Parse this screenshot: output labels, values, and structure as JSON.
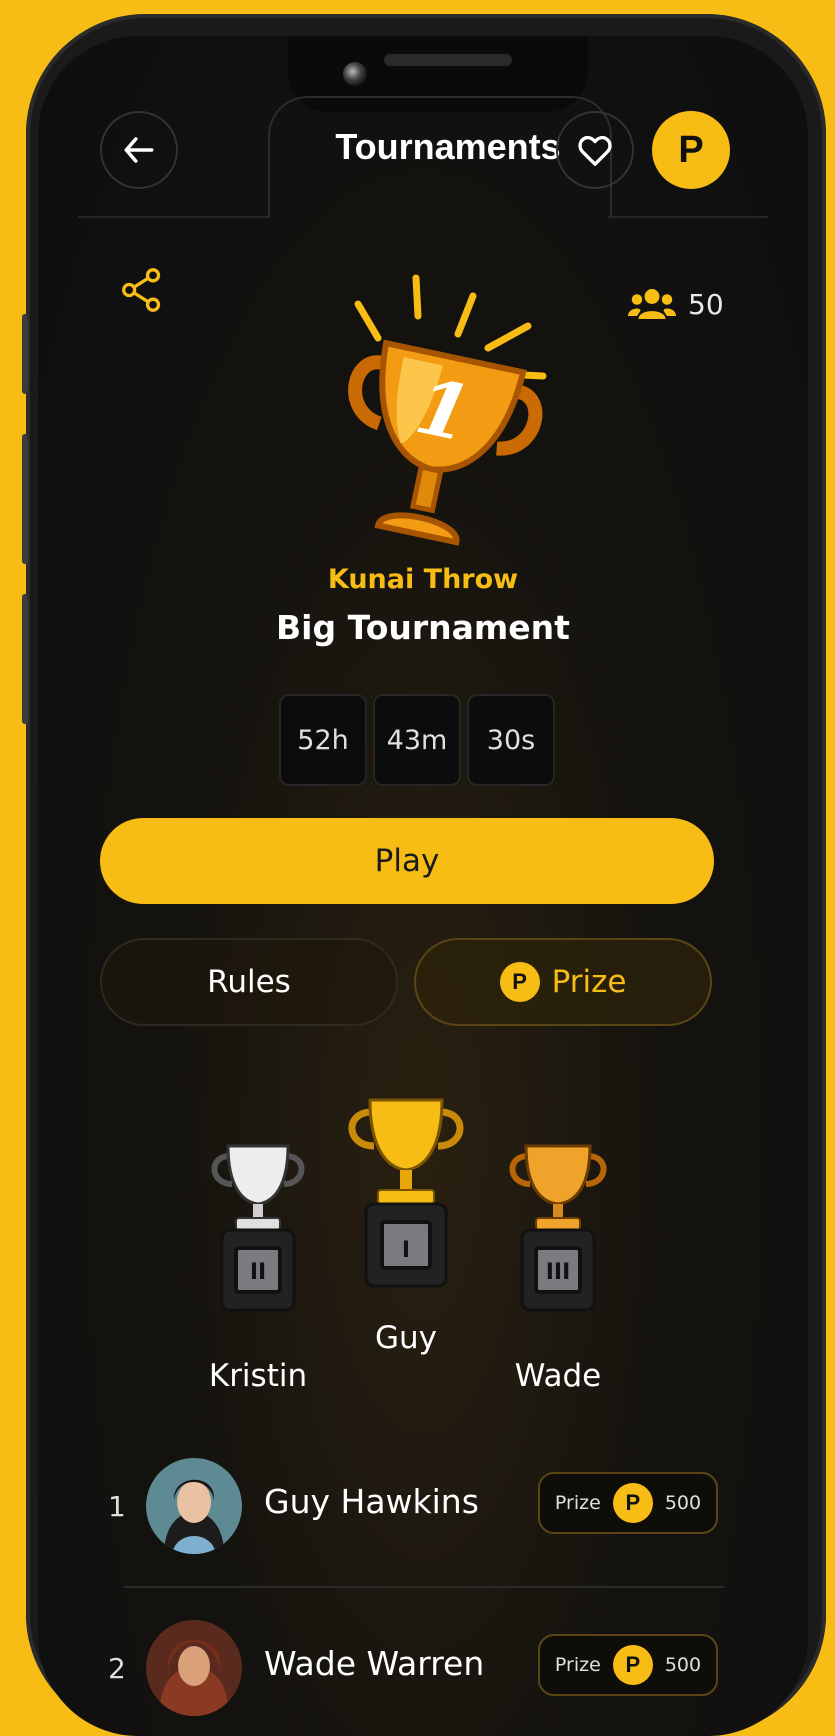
{
  "header": {
    "title": "Tournaments",
    "coin_symbol": "P"
  },
  "participants": {
    "count": "50"
  },
  "tournament": {
    "game": "Kunai Throw",
    "name": "Big Tournament",
    "trophy_number": "1"
  },
  "timer": {
    "hours": "52h",
    "minutes": "43m",
    "seconds": "30s"
  },
  "actions": {
    "play_label": "Play",
    "rules_label": "Rules",
    "prize_label": "Prize"
  },
  "podium": [
    {
      "name": "Kristin",
      "rank_roman": "II",
      "trophy": "silver"
    },
    {
      "name": "Guy",
      "rank_roman": "I",
      "trophy": "gold"
    },
    {
      "name": "Wade",
      "rank_roman": "III",
      "trophy": "bronze"
    }
  ],
  "leaderboard": [
    {
      "rank": "1",
      "name": "Guy Hawkins",
      "prize_label": "Prize",
      "prize_value": "500"
    },
    {
      "rank": "2",
      "name": "Wade Warren",
      "prize_label": "Prize",
      "prize_value": "500"
    }
  ],
  "colors": {
    "accent": "#F8BD14",
    "background": "#0e0e10"
  }
}
